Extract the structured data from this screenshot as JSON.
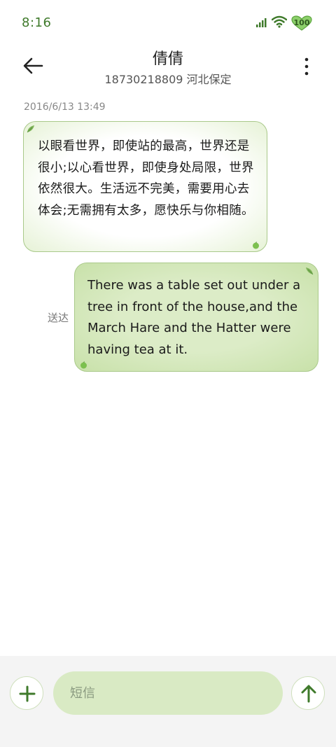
{
  "status_bar": {
    "time": "8:16",
    "battery": "100",
    "icons": [
      "signal-icon",
      "wifi-icon",
      "battery-icon"
    ]
  },
  "header": {
    "contact_name": "倩倩",
    "contact_subtitle": "18730218809 河北保定",
    "back_icon": "arrow-left-icon",
    "more_icon": "more-vertical-icon"
  },
  "conversation": {
    "timestamp": "2016/6/13 13:49",
    "messages": [
      {
        "direction": "incoming",
        "text": "以眼看世界，即使站的最高，世界还是很小;以心看世界，即使身处局限，世界依然很大。生活远不完美，需要用心去体会;无需拥有太多，愿快乐与你相随。"
      },
      {
        "direction": "outgoing",
        "text": "There was a table set out under a tree in front of the house,and the March Hare and the Hatter were having tea at it.",
        "status": "送达"
      }
    ]
  },
  "compose": {
    "placeholder": "短信",
    "add_icon": "plus-icon",
    "send_icon": "arrow-up-icon"
  },
  "colors": {
    "accent": "#3f7a2b",
    "bubble_border": "#a9c98a",
    "outgoing_bubble": "#d2e6b8",
    "input_background": "#d9eac4"
  }
}
